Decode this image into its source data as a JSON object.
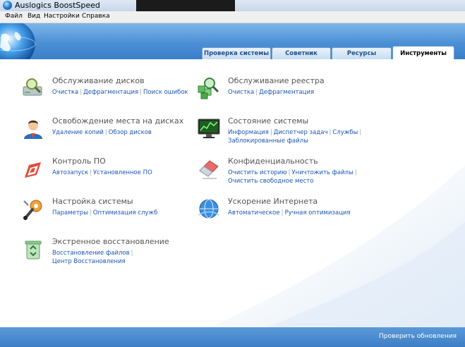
{
  "window": {
    "title": "Auslogics BoostSpeed"
  },
  "menu": [
    "Файл",
    "Вид",
    "Настройки",
    "Справка"
  ],
  "tabs": [
    {
      "label": "Проверка системы",
      "active": false
    },
    {
      "label": "Советник",
      "active": false
    },
    {
      "label": "Ресурсы",
      "active": false
    },
    {
      "label": "Инструменты",
      "active": true
    }
  ],
  "tools": [
    {
      "title": "Обслуживание дисков",
      "icon": "disk-magnifier-icon",
      "links": [
        "Очистка",
        "Дефрагментация",
        "Поиск ошибок"
      ]
    },
    {
      "title": "Обслуживание реестра",
      "icon": "registry-magnifier-icon",
      "links": [
        "Очистка",
        "Дефрагментация"
      ]
    },
    {
      "title": "Освобождение места на дисках",
      "icon": "user-icon",
      "links": [
        "Удаление копий",
        "Обзор дисков"
      ]
    },
    {
      "title": "Состояние системы",
      "icon": "monitor-chart-icon",
      "links": [
        "Информация",
        "Диспетчер задач",
        "Службы",
        "Заблокированные файлы"
      ]
    },
    {
      "title": "Контроль ПО",
      "icon": "software-box-icon",
      "links": [
        "Автозапуск",
        "Установленное ПО"
      ]
    },
    {
      "title": "Конфиденциальность",
      "icon": "eraser-icon",
      "links": [
        "Очистить историю",
        "Уничтожить файлы",
        "Очистить свободное место"
      ]
    },
    {
      "title": "Настройка системы",
      "icon": "wrench-gear-icon",
      "links": [
        "Параметры",
        "Оптимизация служб"
      ]
    },
    {
      "title": "Ускорение Интернета",
      "icon": "globe-network-icon",
      "links": [
        "Автоматическое",
        "Ручная оптимизация"
      ]
    },
    {
      "title": "Экстренное восстановление",
      "icon": "recycle-bin-icon",
      "links": [
        "Восстановление файлов",
        "Центр Восстановления"
      ]
    }
  ],
  "footer": {
    "check_updates": "Проверить обновления"
  },
  "colors": {
    "accent": "#3d7ec4",
    "link": "#1a56b8",
    "title_text": "#555555"
  }
}
